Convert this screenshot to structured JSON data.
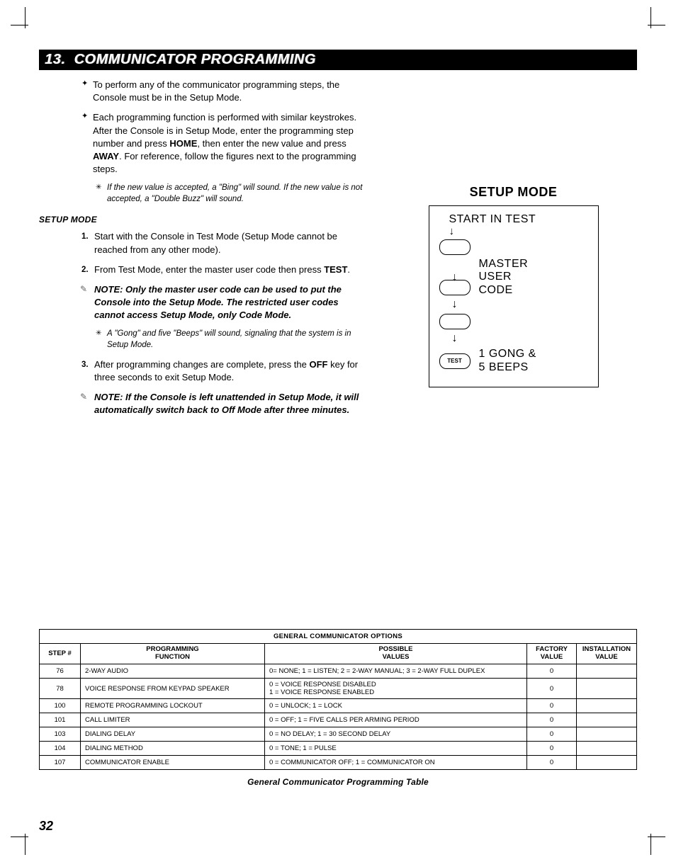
{
  "section": {
    "number": "13.",
    "title": "COMMUNICATOR PROGRAMMING"
  },
  "intro": {
    "b1": "To perform any of the communicator programming steps, the Console must be in the Setup Mode.",
    "b2_pre": "Each programming function is performed with similar keystrokes. After the Console is in Setup Mode, enter the programming step number and press ",
    "b2_kw1": "HOME",
    "b2_mid": ", then enter the new value and press ",
    "b2_kw2": "AWAY",
    "b2_post": ". For reference, follow the figures next to the programming steps.",
    "sub1": "If the new value is accepted, a \"Bing\" will sound. If the new value is not accepted, a \"Double Buzz\" will sound."
  },
  "setup": {
    "heading": "SETUP MODE",
    "s1": "Start with the Console in Test Mode (Setup Mode cannot be reached from any other mode).",
    "s2_pre": "From Test Mode, enter the master user code then press ",
    "s2_kw": "TEST",
    "s2_post": ".",
    "note1": "NOTE: Only the master user code can be used to put the Console into the Setup Mode. The restricted user codes cannot access Setup Mode, only Code Mode.",
    "sub2": "A \"Gong\" and five \"Beeps\" will sound, signaling that the system is in Setup Mode.",
    "s3_pre": "After programming changes are complete, press the ",
    "s3_kw": "OFF",
    "s3_post": " key for three seconds to exit Setup Mode.",
    "note2": "NOTE: If the Console is left unattended in Setup Mode, it will automatically switch back to Off Mode after three minutes."
  },
  "diagram": {
    "title": "SETUP MODE",
    "start": "START IN TEST",
    "master": "MASTER\nUSER\nCODE",
    "test_key": "TEST",
    "result": "1 GONG &\n5 BEEPS"
  },
  "table": {
    "title": "GENERAL COMMUNICATOR OPTIONS",
    "headers": {
      "step": "STEP #",
      "func": "PROGRAMMING\nFUNCTION",
      "vals": "POSSIBLE\nVALUES",
      "factory": "FACTORY\nVALUE",
      "install": "INSTALLATION\nVALUE"
    },
    "rows": [
      {
        "step": "76",
        "func": "2-WAY AUDIO",
        "vals": "0= NONE; 1 = LISTEN; 2 = 2-WAY MANUAL; 3 = 2-WAY FULL DUPLEX",
        "factory": "0",
        "install": ""
      },
      {
        "step": "78",
        "func": "VOICE RESPONSE FROM KEYPAD SPEAKER",
        "vals": "0 = VOICE RESPONSE DISABLED\n1 = VOICE RESPONSE ENABLED",
        "factory": "0",
        "install": ""
      },
      {
        "step": "100",
        "func": "REMOTE PROGRAMMING LOCKOUT",
        "vals": "0 = UNLOCK; 1 = LOCK",
        "factory": "0",
        "install": ""
      },
      {
        "step": "101",
        "func": "CALL LIMITER",
        "vals": "0 = OFF; 1 = FIVE CALLS PER ARMING PERIOD",
        "factory": "0",
        "install": ""
      },
      {
        "step": "103",
        "func": "DIALING DELAY",
        "vals": "0 = NO DELAY; 1 = 30 SECOND DELAY",
        "factory": "0",
        "install": ""
      },
      {
        "step": "104",
        "func": "DIALING METHOD",
        "vals": "0 = TONE; 1 = PULSE",
        "factory": "0",
        "install": ""
      },
      {
        "step": "107",
        "func": "COMMUNICATOR ENABLE",
        "vals": "0 = COMMUNICATOR OFF; 1 = COMMUNICATOR ON",
        "factory": "0",
        "install": ""
      }
    ],
    "caption": "General Communicator Programming Table"
  },
  "page": "32"
}
